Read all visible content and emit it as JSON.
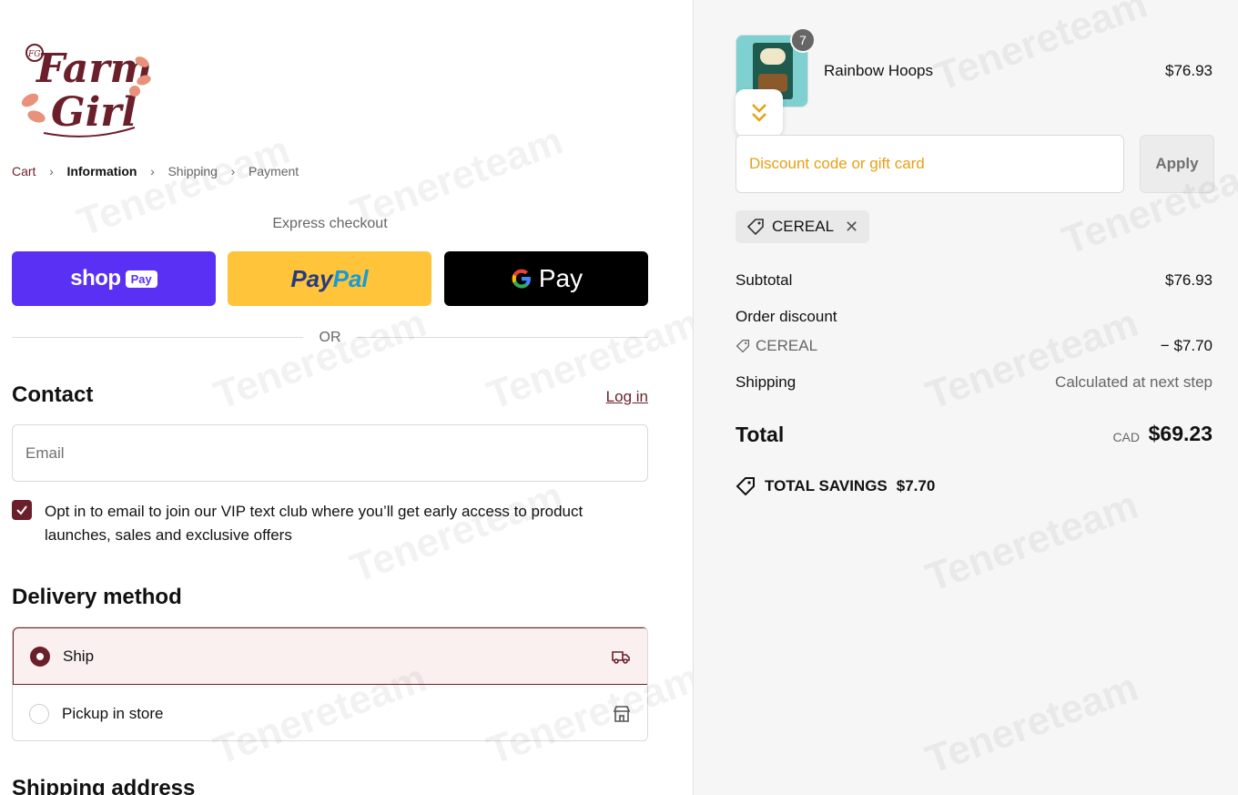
{
  "brand": {
    "logo_text_1": "Farm",
    "logo_text_2": "Girl",
    "logo_initials": "FG"
  },
  "breadcrumb": {
    "items": [
      {
        "label": "Cart",
        "state": "link"
      },
      {
        "label": "Information",
        "state": "current"
      },
      {
        "label": "Shipping",
        "state": "upcoming"
      },
      {
        "label": "Payment",
        "state": "upcoming"
      }
    ]
  },
  "express": {
    "title": "Express checkout",
    "shop_pay": {
      "text": "shop",
      "badge": "Pay"
    },
    "paypal": {
      "part1": "Pay",
      "part2": "Pal"
    },
    "gpay": {
      "text": "Pay"
    },
    "or": "OR"
  },
  "contact": {
    "heading": "Contact",
    "login_label": "Log in",
    "email_placeholder": "Email",
    "email_value": "",
    "opt_in_checked": true,
    "opt_in_label": "Opt in to email to join our VIP text club where you’ll get early access to product launches, sales and exclusive offers"
  },
  "delivery": {
    "heading": "Delivery method",
    "options": [
      {
        "label": "Ship",
        "selected": true,
        "icon": "truck-icon"
      },
      {
        "label": "Pickup in store",
        "selected": false,
        "icon": "store-icon"
      }
    ]
  },
  "shipping_address": {
    "heading": "Shipping address"
  },
  "order": {
    "item": {
      "name": "Rainbow Hoops",
      "price": "$76.93",
      "quantity": "7"
    },
    "discount_placeholder": "Discount code or gift card",
    "apply_label": "Apply",
    "applied_code": "CEREAL",
    "subtotal_label": "Subtotal",
    "subtotal_value": "$76.93",
    "order_discount_label": "Order discount",
    "discount_code_label": "CEREAL",
    "discount_value": "− $7.70",
    "shipping_label": "Shipping",
    "shipping_value": "Calculated at next step",
    "total_label": "Total",
    "currency": "CAD",
    "total_value": "$69.23",
    "savings_label": "TOTAL SAVINGS",
    "savings_value": "$7.70"
  },
  "colors": {
    "brand_maroon": "#6b1f2a",
    "shop_pay": "#5a31f4",
    "paypal": "#ffc439",
    "gpay": "#000000",
    "discount_placeholder": "#e6a117"
  }
}
